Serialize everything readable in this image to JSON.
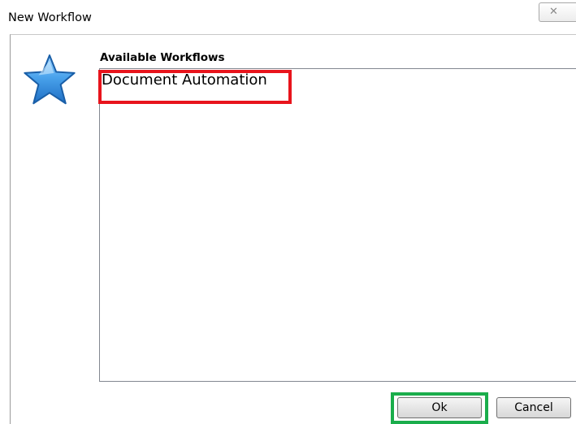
{
  "window": {
    "title": "New Workflow",
    "close_glyph": "✕"
  },
  "icon": {
    "name": "star-icon",
    "color": "#2f86d6"
  },
  "workflows": {
    "label": "Available Workflows",
    "items": [
      "Document Automation"
    ]
  },
  "buttons": {
    "ok": "Ok",
    "cancel": "Cancel"
  },
  "annotations": {
    "red_highlight_color": "#e8141c",
    "green_highlight_color": "#1aad4b"
  }
}
